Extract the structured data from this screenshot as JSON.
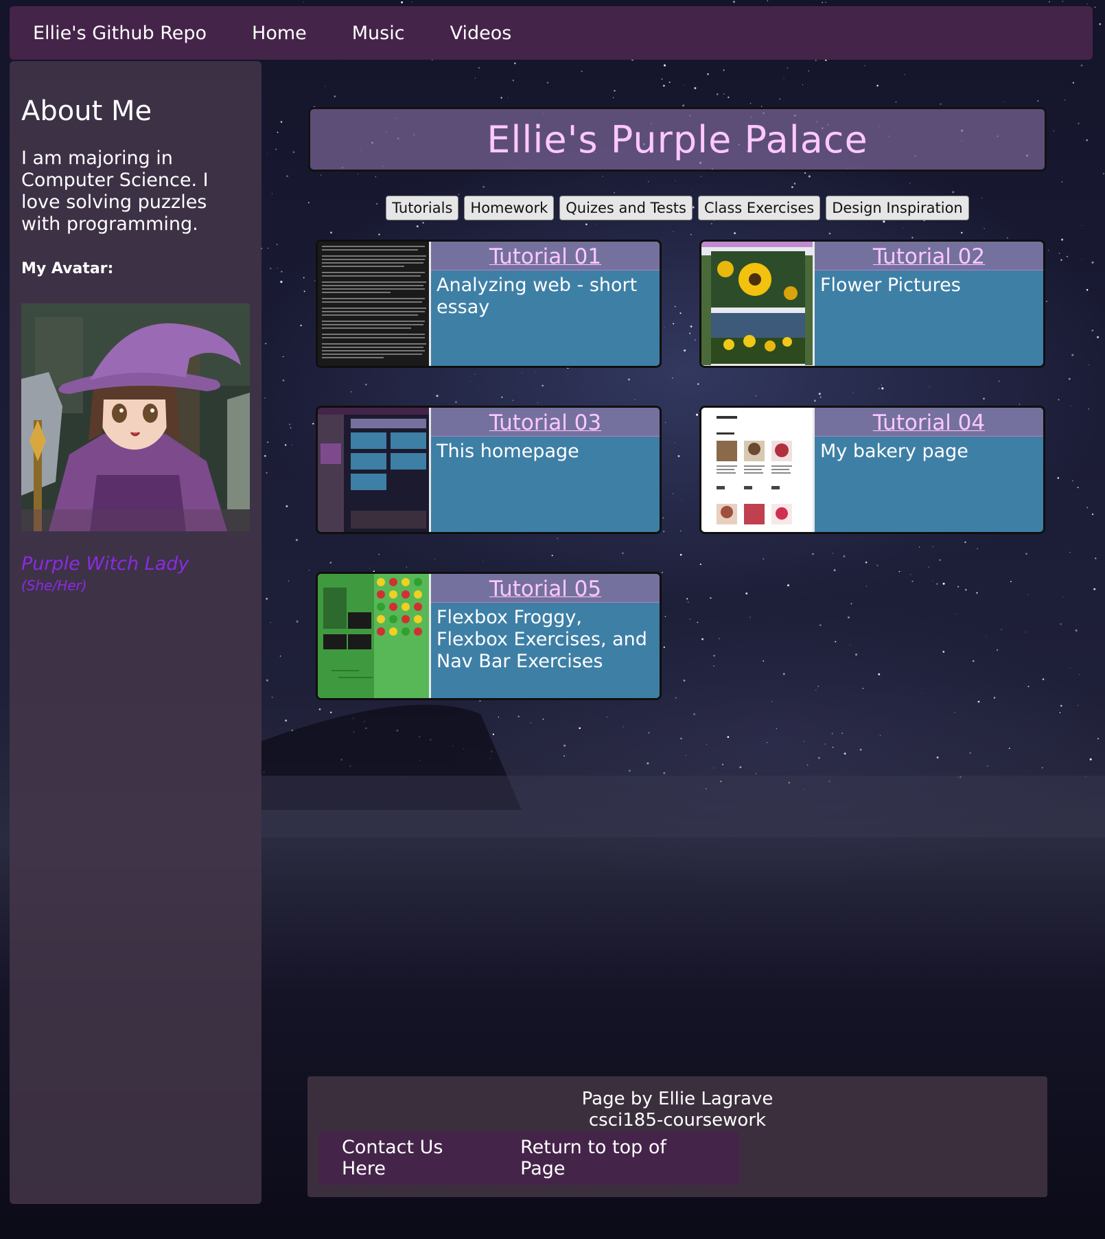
{
  "nav": {
    "brand": "Ellie's Github Repo",
    "links": [
      "Home",
      "Music",
      "Videos"
    ]
  },
  "sidebar": {
    "title": "About Me",
    "bio": "I am majoring in Computer Science. I love solving puzzles with programming.",
    "avatar_label": "My Avatar:",
    "avatar_name": "Purple Witch Lady",
    "avatar_pronoun": "(She/Her)"
  },
  "header": {
    "title": "Ellie's Purple Palace"
  },
  "tabs": [
    "Tutorials",
    "Homework",
    "Quizes and Tests",
    "Class Exercises",
    "Design Inspiration"
  ],
  "cards": [
    {
      "title": "Tutorial 01",
      "desc": "Analyzing web - short essay"
    },
    {
      "title": "Tutorial 02",
      "desc": "Flower Pictures"
    },
    {
      "title": "Tutorial 03",
      "desc": "This homepage"
    },
    {
      "title": "Tutorial 04",
      "desc": "My bakery page"
    },
    {
      "title": "Tutorial 05",
      "desc": "Flexbox Froggy, Flexbox Exercises, and Nav Bar Exercises"
    }
  ],
  "footer": {
    "line1": "Page by Ellie Lagrave",
    "line2": "csci185-coursework",
    "links": [
      "Contact Us Here",
      "Return to top of Page"
    ]
  },
  "colors": {
    "nav_bg": "#45244a",
    "title_text": "#ffc8ff",
    "card_body": "#3e7fa6",
    "card_title_bg": "#74719e",
    "avatar_name": "#8a2be2"
  }
}
